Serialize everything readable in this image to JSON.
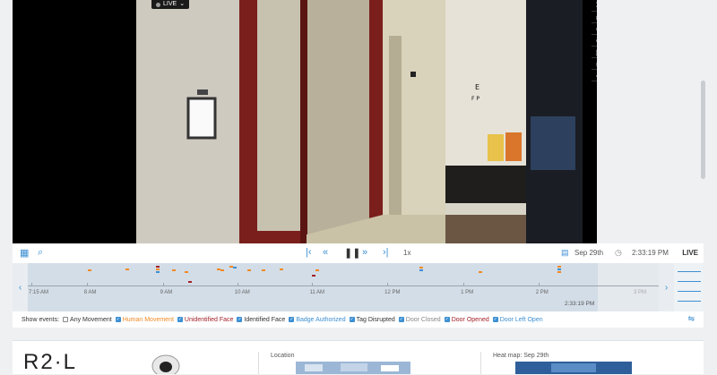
{
  "video": {
    "live_badge": "LIVE"
  },
  "controls": {
    "speed": "1x",
    "date": "Sep 29th",
    "time": "2:33:19 PM",
    "live_label": "LIVE"
  },
  "timeline": {
    "ticks": [
      {
        "label": "7:15 AM",
        "frac": 0.0
      },
      {
        "label": "8 AM",
        "frac": 0.101
      },
      {
        "label": "9 AM",
        "frac": 0.24
      },
      {
        "label": "10 AM",
        "frac": 0.376
      },
      {
        "label": "11 AM",
        "frac": 0.513
      },
      {
        "label": "12 PM",
        "frac": 0.65
      },
      {
        "label": "1 PM",
        "frac": 0.789
      },
      {
        "label": "2 PM",
        "frac": 0.926
      }
    ],
    "now_label": "2:33:19 PM",
    "future_label": "3 PM"
  },
  "events": {
    "label": "Show events:",
    "items": [
      {
        "label": "Any Movement",
        "checked": false,
        "color": "#333333"
      },
      {
        "label": "Human Movement",
        "checked": true,
        "color": "#f08a24"
      },
      {
        "label": "Unidentified Face",
        "checked": true,
        "color": "#a3222a"
      },
      {
        "label": "Identified Face",
        "checked": true,
        "color": "#333333"
      },
      {
        "label": "Badge Authorized",
        "checked": true,
        "color": "#3c8fd2"
      },
      {
        "label": "Tag Disrupted",
        "checked": true,
        "color": "#333333"
      },
      {
        "label": "Door Closed",
        "checked": true,
        "color": "#888888"
      },
      {
        "label": "Door Opened",
        "checked": true,
        "color": "#a3222a"
      },
      {
        "label": "Door Left Open",
        "checked": true,
        "color": "#3c8fd2"
      }
    ]
  },
  "cards": {
    "logo": "R2·L",
    "location_title": "Location",
    "heatmap_title": "Heat map: Sep 29th"
  },
  "colors": {
    "accent": "#3c8fd2"
  }
}
